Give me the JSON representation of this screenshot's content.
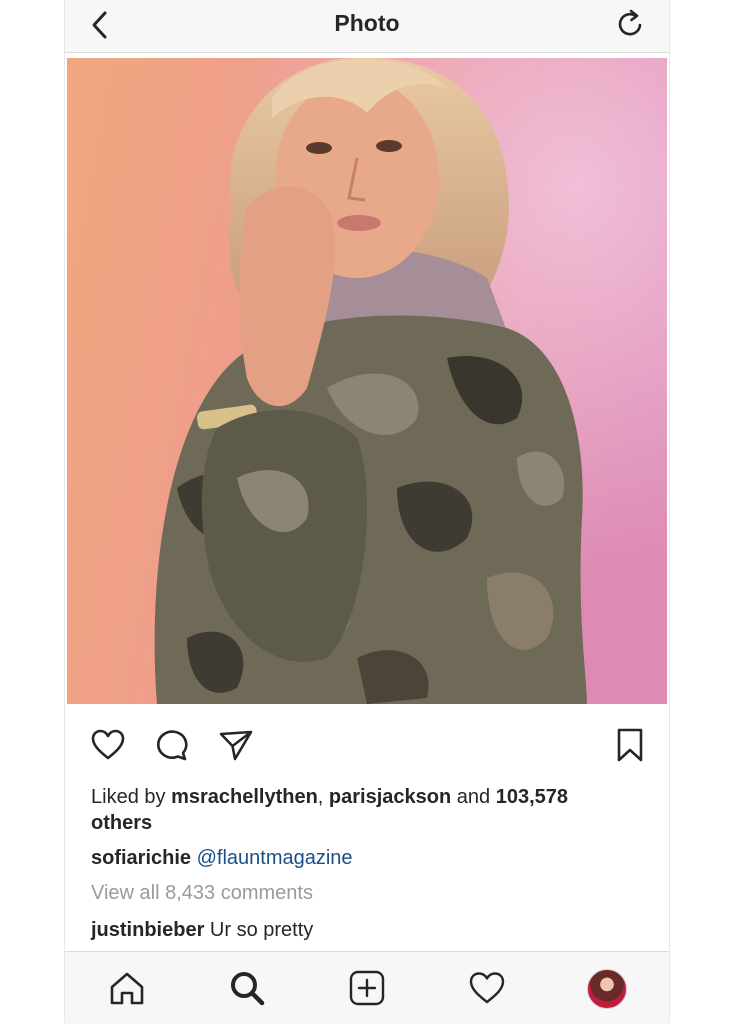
{
  "header": {
    "title": "Photo",
    "back_icon": "back-chevron-icon",
    "refresh_icon": "refresh-icon"
  },
  "post": {
    "image_alt": "Photo of a blonde woman in a camouflage jacket and grey hoodie against a pink background",
    "actions": [
      "heart-icon",
      "comment-icon",
      "share-icon",
      "bookmark-icon"
    ],
    "likes": {
      "prefix": "Liked by ",
      "user1": "msrachellythen",
      "separator": ", ",
      "user2": "parisjackson",
      "middle": " and ",
      "count": "103,578",
      "suffix": "others"
    },
    "caption": {
      "username": "sofiarichie",
      "mention": "@flauntmagazine"
    },
    "view_all_comments": "View all 8,433 comments",
    "comment": {
      "username": "justinbieber",
      "text": "Ur so pretty"
    }
  },
  "tabbar": {
    "items": [
      "home-icon",
      "search-icon",
      "new-post-icon",
      "activity-heart-icon",
      "profile-avatar"
    ]
  },
  "colors": {
    "text": "#262626",
    "muted": "#9a9a9a",
    "mention": "#1a4f8a",
    "bar_bg": "#f7f7f7"
  }
}
